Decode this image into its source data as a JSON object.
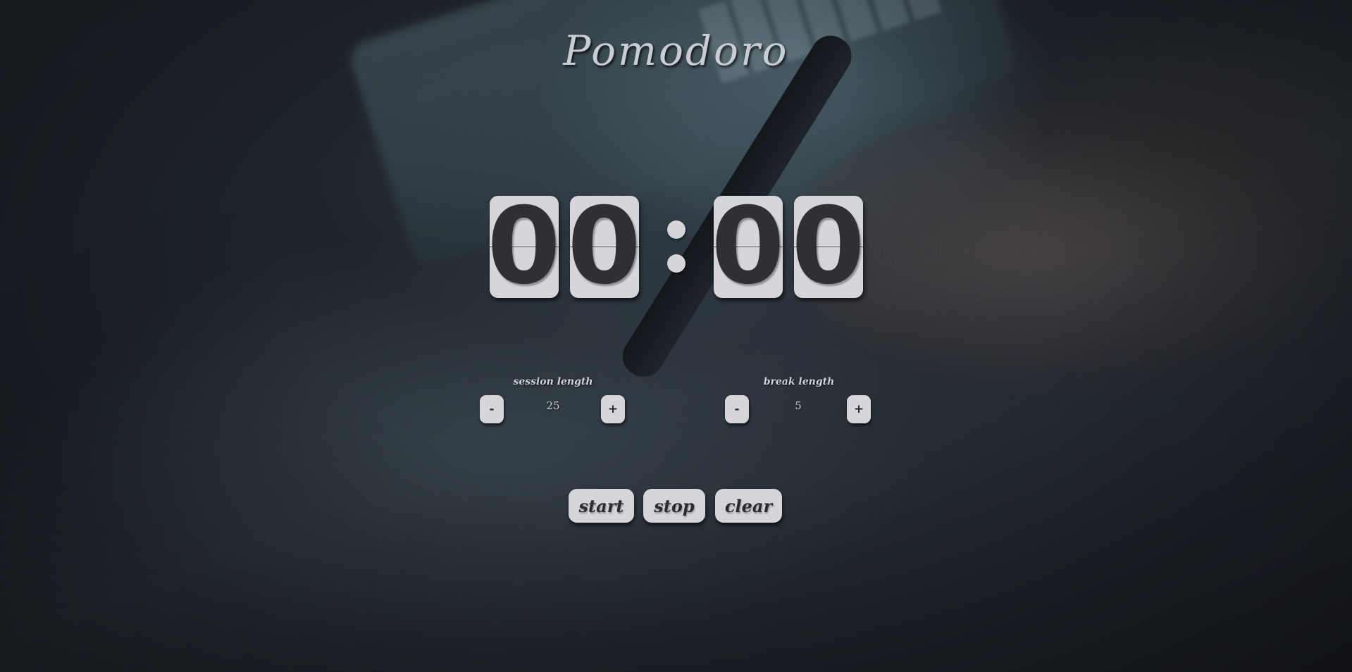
{
  "app": {
    "title": "Pomodoro"
  },
  "timer": {
    "minutes_tens": "0",
    "minutes_ones": "0",
    "seconds_tens": "0",
    "seconds_ones": "0"
  },
  "session": {
    "label": "session length",
    "value": "25",
    "decrement_label": "-",
    "increment_label": "+"
  },
  "break": {
    "label": "break length",
    "value": "5",
    "decrement_label": "-",
    "increment_label": "+"
  },
  "controls": {
    "start_label": "start",
    "stop_label": "stop",
    "clear_label": "clear"
  },
  "colors": {
    "tile": "#d7d5d9",
    "digit": "#2f2f34",
    "title": "#c9cdd3"
  }
}
